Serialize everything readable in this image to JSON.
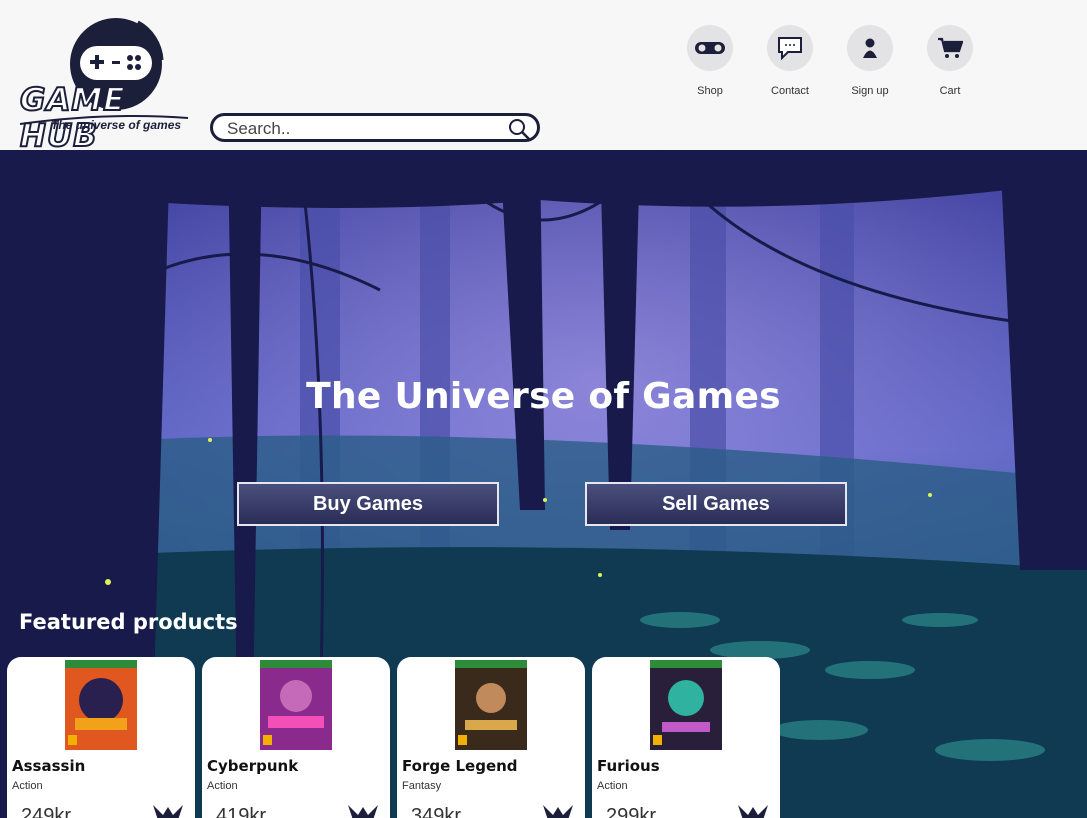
{
  "brand": {
    "name": "GAME HUB",
    "tagline": "The universe of games"
  },
  "search": {
    "placeholder": "Search.."
  },
  "nav": [
    {
      "label": "Shop",
      "icon": "gamepad-icon"
    },
    {
      "label": "Contact",
      "icon": "chat-icon"
    },
    {
      "label": "Sign up",
      "icon": "user-icon"
    },
    {
      "label": "Cart",
      "icon": "cart-icon"
    }
  ],
  "hero": {
    "title": "The Universe of Games",
    "buy_label": "Buy Games",
    "sell_label": "Sell Games"
  },
  "featured": {
    "heading": "Featured products",
    "products": [
      {
        "name": "Assassin",
        "genre": "Action",
        "price": "249kr",
        "cover_color": "#e0581f"
      },
      {
        "name": "Cyberpunk",
        "genre": "Action",
        "price": "419kr",
        "cover_color": "#8a2a8c"
      },
      {
        "name": "Forge Legend",
        "genre": "Fantasy",
        "price": "349kr",
        "cover_color": "#3a2a1c"
      },
      {
        "name": "Furious",
        "genre": "Action",
        "price": "299kr",
        "cover_color": "#2a1f3a"
      }
    ]
  },
  "colors": {
    "dark": "#1c1f3a",
    "button": "#2a2d55",
    "nav_bg": "#e3e3e6"
  }
}
